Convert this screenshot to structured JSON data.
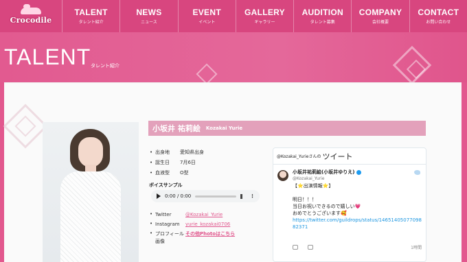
{
  "header": {
    "logo_text": "Crocodile",
    "nav": [
      {
        "en": "TALENT",
        "ja": "タレント紹介"
      },
      {
        "en": "NEWS",
        "ja": "ニュース"
      },
      {
        "en": "EVENT",
        "ja": "イベント"
      },
      {
        "en": "GALLERY",
        "ja": "ギャラリー"
      },
      {
        "en": "AUDITION",
        "ja": "タレント募集"
      },
      {
        "en": "COMPANY",
        "ja": "会社概要"
      },
      {
        "en": "CONTACT",
        "ja": "お問い合わせ"
      }
    ]
  },
  "hero": {
    "title": "TALENT",
    "subtitle": "タレント紹介"
  },
  "talent": {
    "name_jp": "小坂井 祐莉絵",
    "name_en": "Kozakai Yurie",
    "profile": [
      {
        "bullet": "•",
        "key": "出身地",
        "value": "愛知県出身"
      },
      {
        "bullet": "•",
        "key": "誕生日",
        "value": "7月6日"
      },
      {
        "bullet": "•",
        "key": "血液型",
        "value": "O型"
      }
    ],
    "voice_title": "ボイスサンプル",
    "audio_time": "0:00 / 0:00",
    "social": [
      {
        "bullet": "•",
        "key": "Twitter",
        "value": "@Kozakai_Yurie",
        "bold": false
      },
      {
        "bullet": "•",
        "key": "Instagram",
        "value": "yurie_kozakai0706",
        "bold": false
      },
      {
        "bullet": "•",
        "key": "プロフィール画像",
        "value": "その他Photoはこちら",
        "bold": true
      }
    ]
  },
  "twitter": {
    "header_handle": "@Kozakai_Yurieさんの",
    "header_label": "ツイート",
    "name": "小坂井祐莉絵(小坂井ゆりえ)",
    "handle": "@Kozakai_Yurie",
    "text": "【⭐出演情報⭐】\n\n明日！！！\n当日お祝いできるので嬉しい💗\nおめでとうございます🥰",
    "link": "https://twitter.com/guildrops/status/1465140507709882371",
    "time": "1時間"
  },
  "colors": {
    "brand_pink": "#e2588e",
    "nav_pink": "#d8467f",
    "name_bar": "#e3a1bb",
    "link_pink": "#e0558c",
    "tweet_link": "#1b95e0"
  }
}
